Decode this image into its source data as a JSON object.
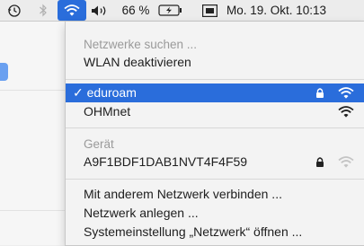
{
  "menubar": {
    "icons": [
      "time-machine-icon",
      "bluetooth-icon",
      "wifi-icon",
      "volume-icon",
      "battery-icon",
      "keyboard-icon"
    ],
    "battery_percent": "66 %",
    "datetime": "Mo. 19. Okt.  10:13"
  },
  "wifi_menu": {
    "searching_label": "Netzwerke suchen ...",
    "disable_label": "WLAN deaktivieren",
    "networks": [
      {
        "name": "eduroam",
        "connected": true,
        "locked": true
      },
      {
        "name": "OHMnet",
        "connected": false,
        "locked": false
      }
    ],
    "devices_header": "Gerät",
    "devices": [
      {
        "name": "A9F1BDF1DAB1NVT4F4F59",
        "locked": true
      }
    ],
    "actions": [
      "Mit anderem Netzwerk verbinden ...",
      "Netzwerk anlegen ...",
      "Systemeinstellung „Netzwerk“ öffnen ..."
    ]
  },
  "colors": {
    "selection": "#2a6ddb",
    "menu_bg": "#f3f3f3",
    "disabled_text": "#9a9a9a"
  }
}
